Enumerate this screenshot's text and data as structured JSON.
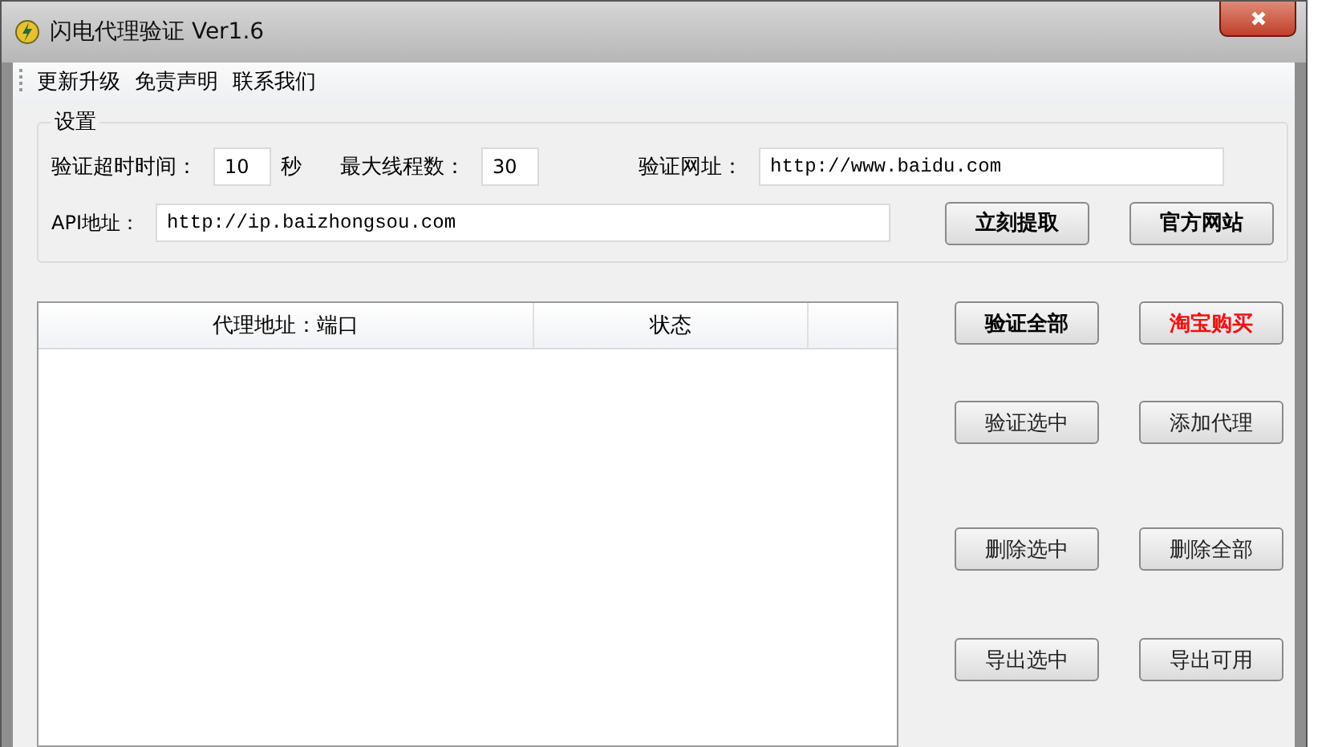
{
  "window": {
    "title": "闪电代理验证 Ver1.6"
  },
  "menu": [
    "更新升级",
    "免责声明",
    "联系我们"
  ],
  "settings": {
    "title": "设置",
    "timeout": {
      "label": "验证超时时间：",
      "value": "10",
      "unit": "秒"
    },
    "threads": {
      "label": "最大线程数：",
      "value": "30"
    },
    "verify_url": {
      "label": "验证网址：",
      "value": "http://www.baidu.com"
    },
    "api": {
      "label": "API地址：",
      "value": "http://ip.baizhongsou.com"
    },
    "buttons": [
      {
        "label": "立刻提取",
        "kind": "bold"
      },
      {
        "label": "官方网站",
        "kind": "bold"
      }
    ]
  },
  "table": {
    "columns": [
      "代理地址：端口",
      "状态"
    ]
  },
  "actions": [
    {
      "label": "验证全部",
      "kind": "bold"
    },
    {
      "label": "淘宝购买",
      "kind": "warning"
    },
    {
      "label": "验证选中",
      "kind": "plain"
    },
    {
      "label": "添加代理",
      "kind": "plain"
    },
    {
      "label": "删除选中",
      "kind": "plain"
    },
    {
      "label": "删除全部",
      "kind": "plain"
    },
    {
      "label": "导出选中",
      "kind": "plain"
    },
    {
      "label": "导出可用",
      "kind": "plain"
    }
  ]
}
